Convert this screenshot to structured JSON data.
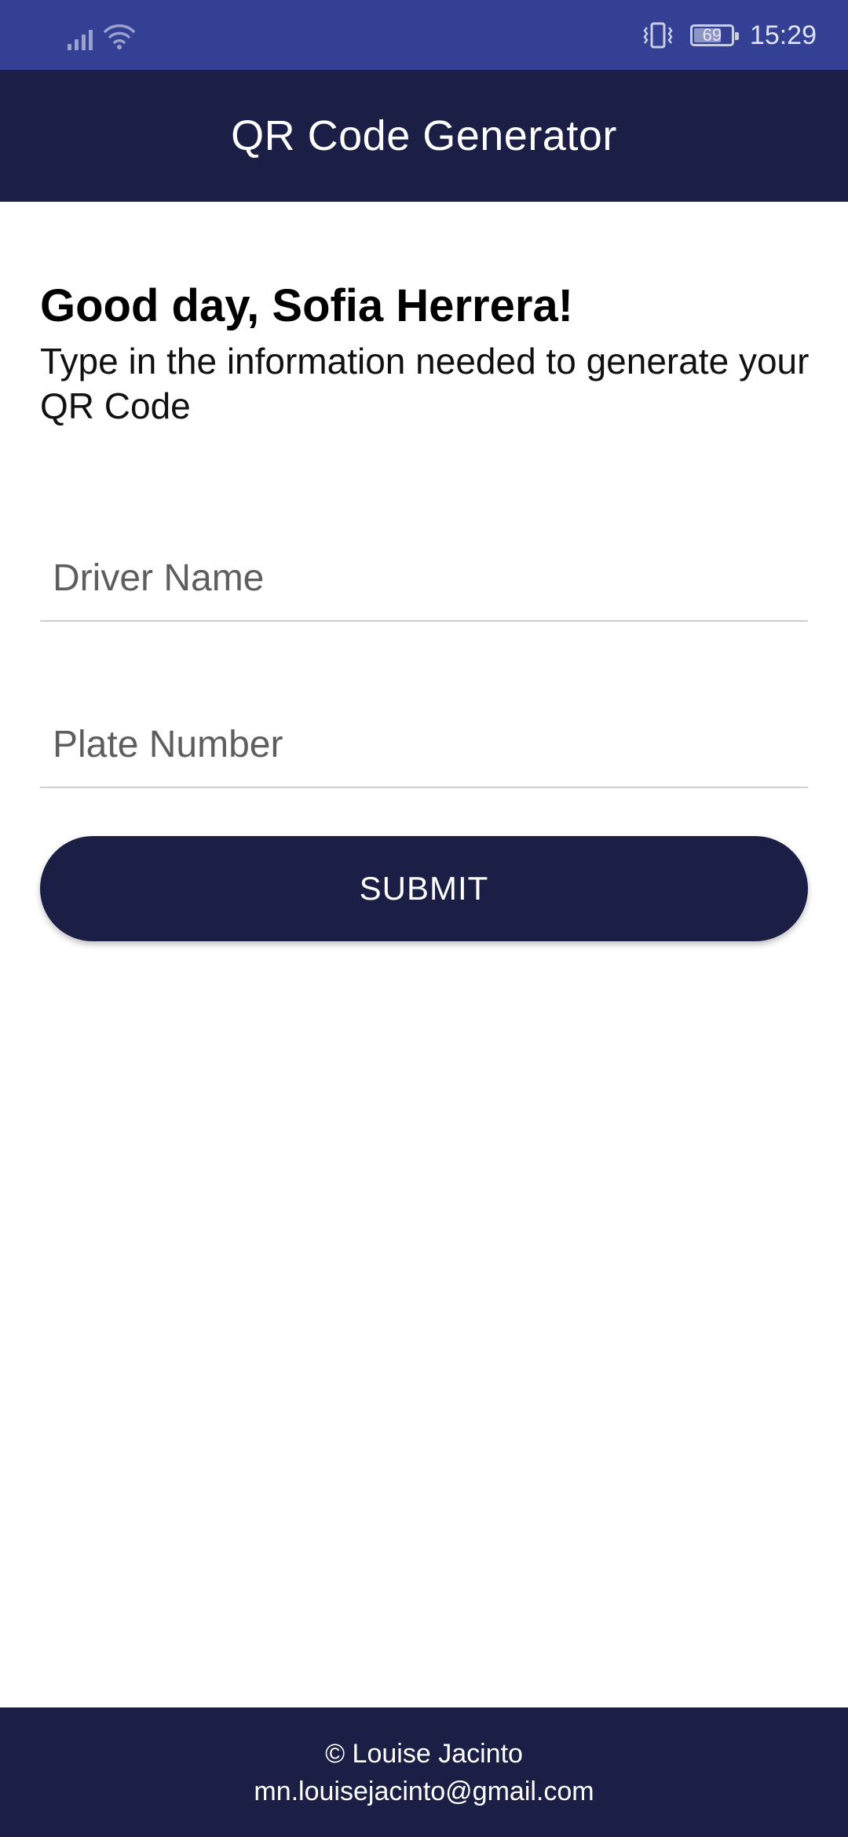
{
  "status_bar": {
    "time": "15:29",
    "battery_level": "69",
    "icons": [
      "signal-icon",
      "wifi-icon",
      "vibrate-icon",
      "battery-icon"
    ],
    "background_color": "#334093"
  },
  "app_bar": {
    "title": "QR Code Generator",
    "background_color": "#1b1f45"
  },
  "main": {
    "greeting": "Good day, Sofia Herrera!",
    "instructions": "Type in the information needed to generate your QR Code",
    "driver_name": {
      "placeholder": "Driver Name",
      "value": ""
    },
    "plate_number": {
      "placeholder": "Plate Number",
      "value": ""
    },
    "submit_label": "SUBMIT"
  },
  "footer": {
    "copyright": "© Louise Jacinto",
    "email": "mn.louisejacinto@gmail.com"
  }
}
